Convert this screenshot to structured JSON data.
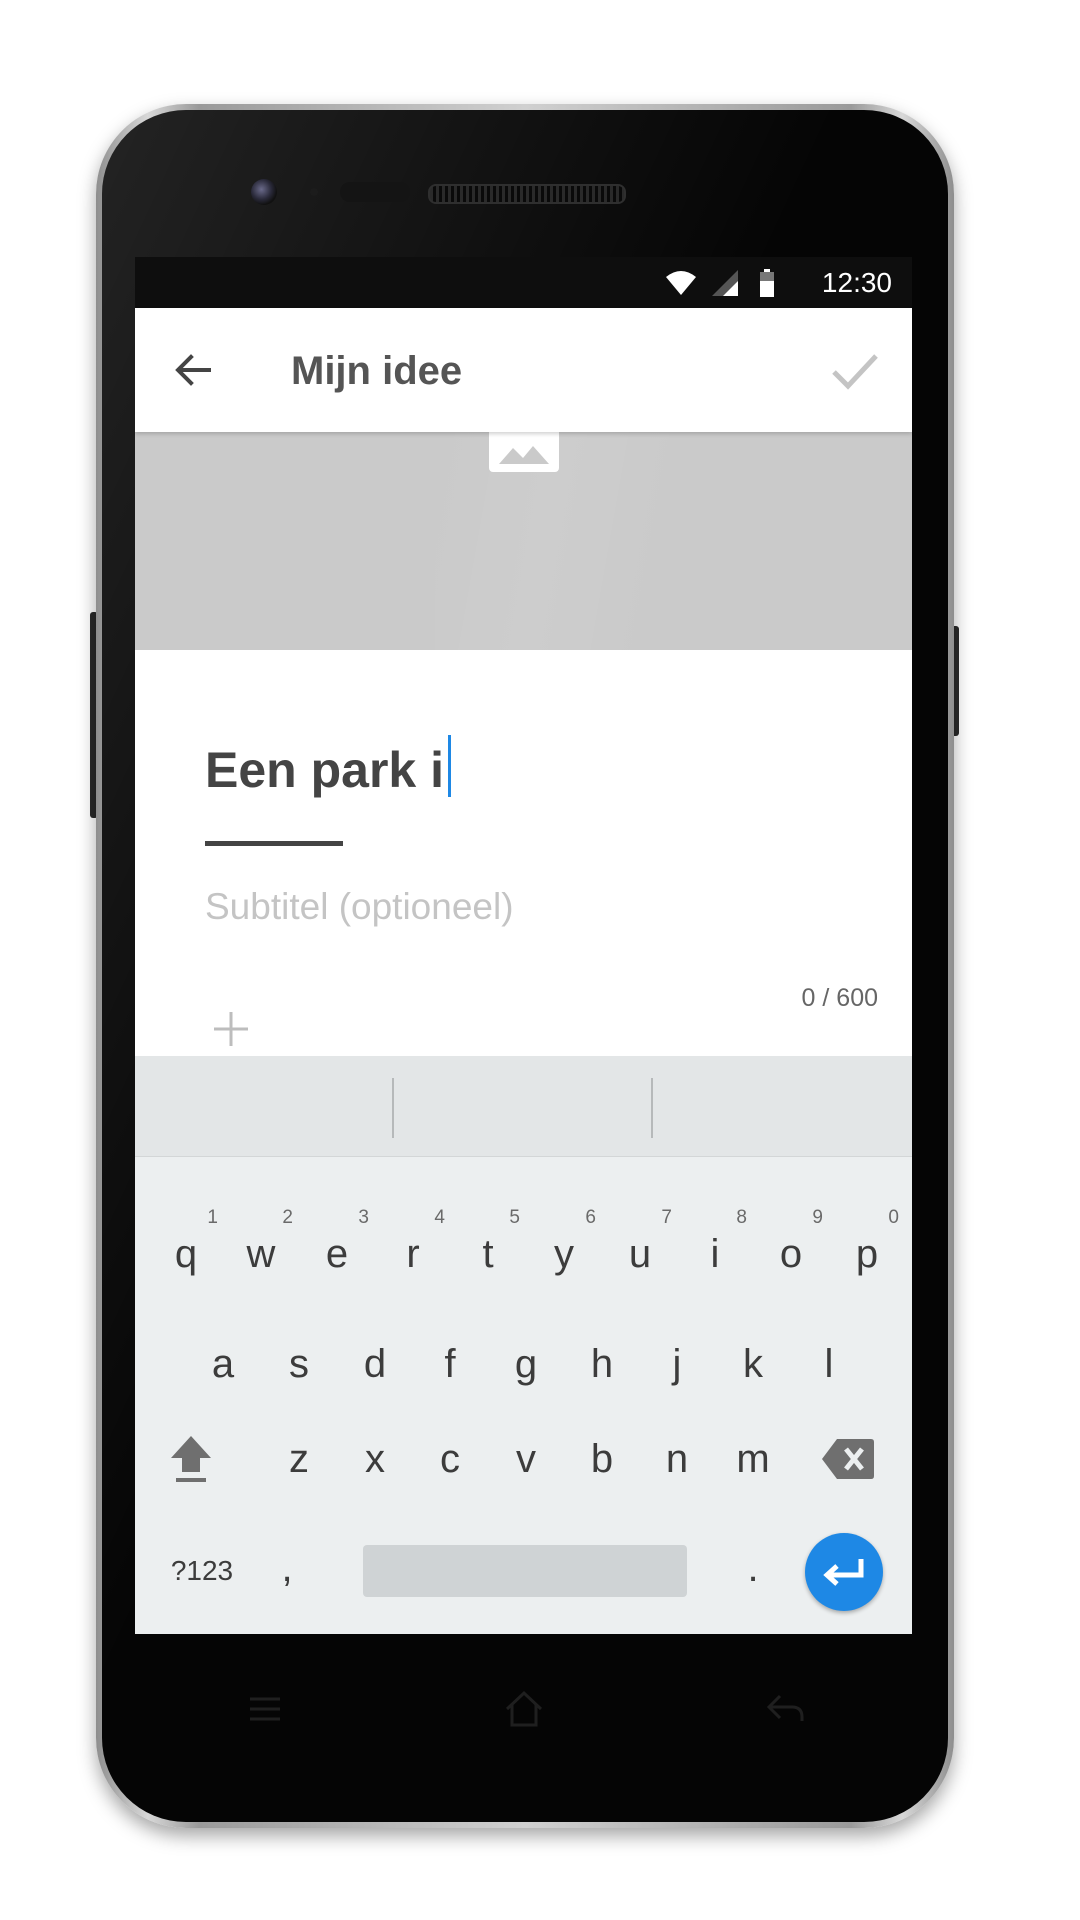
{
  "status_bar": {
    "time": "12:30"
  },
  "app_bar": {
    "title": "Mijn idee"
  },
  "editor": {
    "title_value": "Een park i",
    "subtitle_placeholder": "Subtitel (optioneel)",
    "char_count": "0 / 600"
  },
  "keyboard": {
    "row1": [
      {
        "letter": "q",
        "hint": "1"
      },
      {
        "letter": "w",
        "hint": "2"
      },
      {
        "letter": "e",
        "hint": "3"
      },
      {
        "letter": "r",
        "hint": "4"
      },
      {
        "letter": "t",
        "hint": "5"
      },
      {
        "letter": "y",
        "hint": "6"
      },
      {
        "letter": "u",
        "hint": "7"
      },
      {
        "letter": "i",
        "hint": "8"
      },
      {
        "letter": "o",
        "hint": "9"
      },
      {
        "letter": "p",
        "hint": "0"
      }
    ],
    "row2": [
      "a",
      "s",
      "d",
      "f",
      "g",
      "h",
      "j",
      "k",
      "l"
    ],
    "row3": [
      "z",
      "x",
      "c",
      "v",
      "b",
      "n",
      "m"
    ],
    "symbols_key": "?123",
    "comma_key": ",",
    "period_key": "."
  },
  "colors": {
    "accent": "#1e88e5",
    "cover_placeholder": "#cacaca",
    "keyboard_bg": "#eceff0"
  },
  "icons": {
    "back": "arrow-left-icon",
    "confirm": "check-icon",
    "image": "image-placeholder-icon",
    "add": "plus-icon",
    "shift": "shift-icon",
    "delete": "backspace-icon",
    "enter": "enter-icon",
    "nav_menu": "menu-icon",
    "nav_home": "home-icon",
    "nav_back": "back-nav-icon"
  }
}
